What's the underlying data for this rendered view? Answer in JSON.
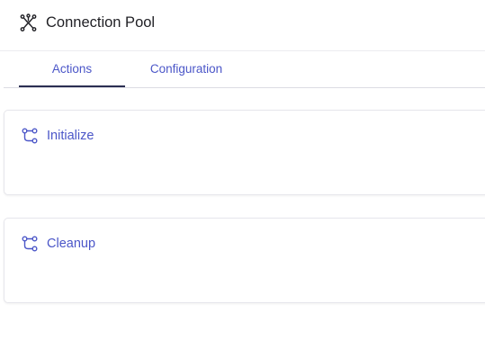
{
  "header": {
    "title": "Connection Pool",
    "icon": "connection-pool-icon"
  },
  "tabs": [
    {
      "label": "Actions",
      "active": true
    },
    {
      "label": "Configuration",
      "active": false
    }
  ],
  "actions": [
    {
      "label": "Initialize",
      "icon": "workflow-icon"
    },
    {
      "label": "Cleanup",
      "icon": "workflow-icon"
    }
  ],
  "colors": {
    "accent": "#4b56c8",
    "active_tab_underline": "#2b2f52",
    "title_text": "#1f1f24"
  }
}
